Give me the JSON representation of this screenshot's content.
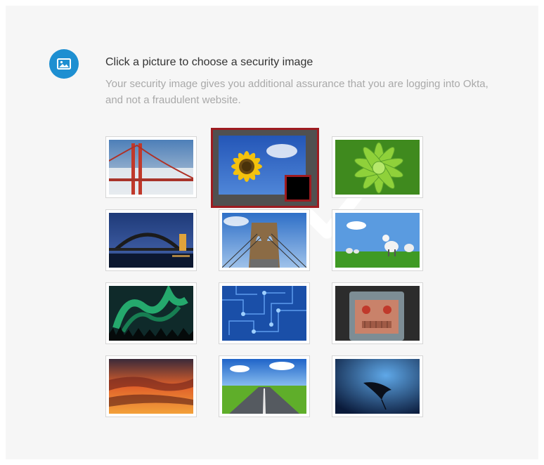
{
  "header": {
    "icon": "image-icon",
    "title": "Click a picture to choose a security image",
    "description": "Your security image gives you additional assurance that you are logging into Okta, and not a fraudulent website."
  },
  "colors": {
    "accent": "#1e8fd1",
    "selected_border": "#9e1b20"
  },
  "images": [
    {
      "name": "golden-gate-bridge",
      "selected": false
    },
    {
      "name": "sunflower",
      "selected": true
    },
    {
      "name": "succulent-plant",
      "selected": false
    },
    {
      "name": "sydney-harbour-bridge",
      "selected": false
    },
    {
      "name": "brooklyn-bridge",
      "selected": false
    },
    {
      "name": "lambs-on-grass",
      "selected": false
    },
    {
      "name": "northern-lights",
      "selected": false
    },
    {
      "name": "circuit-board",
      "selected": false
    },
    {
      "name": "toy-robot",
      "selected": false
    },
    {
      "name": "sunset-clouds",
      "selected": false
    },
    {
      "name": "country-road",
      "selected": false
    },
    {
      "name": "manta-ray",
      "selected": false
    }
  ]
}
